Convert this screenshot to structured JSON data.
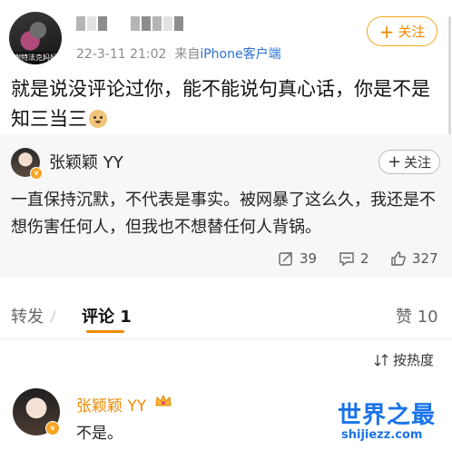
{
  "post": {
    "author_caption": "谢特法克妈妈",
    "timestamp": "22-3-11 21:02",
    "source_prefix": "来自",
    "source": "iPhone客户端",
    "follow_label": "关注",
    "follow_plus": "+",
    "text": "就是说没评论过你，能不能说句真心话，你是不是知三当三"
  },
  "repost": {
    "author": "张颖颖 YY",
    "follow_label": "关注",
    "follow_plus": "+",
    "text": "一直保持沉默，不代表是事实。被网暴了这么久，我还是不想伤害任何人，但我也不想替任何人背锅。",
    "shares": "39",
    "comments": "2",
    "likes": "327"
  },
  "tabs": {
    "repost": "转发",
    "comments": "评论 1",
    "likes": "赞 10"
  },
  "sort_label": "按热度",
  "comment": {
    "author": "张颖颖 YY",
    "text": "不是。"
  },
  "watermark": {
    "title": "世界之最",
    "url": "shijiezz.com"
  },
  "colors": {
    "accent": "#f08a00",
    "link": "#2c6fd6",
    "watermark": "#1a73e8"
  }
}
